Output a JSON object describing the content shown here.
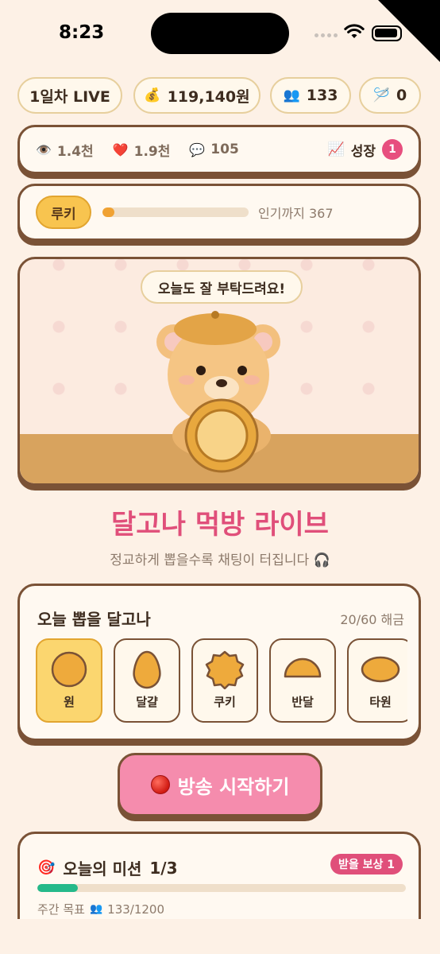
{
  "status": {
    "time": "8:23"
  },
  "chips": {
    "live": "1일차 LIVE",
    "money": "119,140원",
    "followers": "133",
    "needles": "0"
  },
  "stats": {
    "views": "1.4천",
    "likes": "1.9천",
    "comments": "105",
    "growth_label": "성장",
    "growth_badge": "1"
  },
  "rank": {
    "tier": "루키",
    "progress": 0.08,
    "next_text": "인기까지 367"
  },
  "stage": {
    "speech": "오늘도 잘 부탁드려요!"
  },
  "title": "달고나 먹방 라이브",
  "subtitle": "정교하게 뽑을수록 채팅이 터집니다 🎧",
  "picker": {
    "heading": "오늘 뽑을 달고나",
    "unlock_count": "20/60 해금",
    "shapes": [
      {
        "label": "원",
        "selected": true
      },
      {
        "label": "달걀",
        "selected": false
      },
      {
        "label": "쿠키",
        "selected": false
      },
      {
        "label": "반달",
        "selected": false
      },
      {
        "label": "타원",
        "selected": false
      }
    ]
  },
  "start_button": "방송 시작하기",
  "mission": {
    "title": "오늘의 미션",
    "progress_text": "1/3",
    "reward_badge": "받을 보상 1",
    "progress": 0.11,
    "weekly_label": "주간 목표",
    "weekly_value": "133/1200"
  },
  "colors": {
    "accent_pink": "#e04f7a",
    "brown_border": "#7a5236",
    "gold": "#f8c44f",
    "mission_green": "#25b98a"
  }
}
